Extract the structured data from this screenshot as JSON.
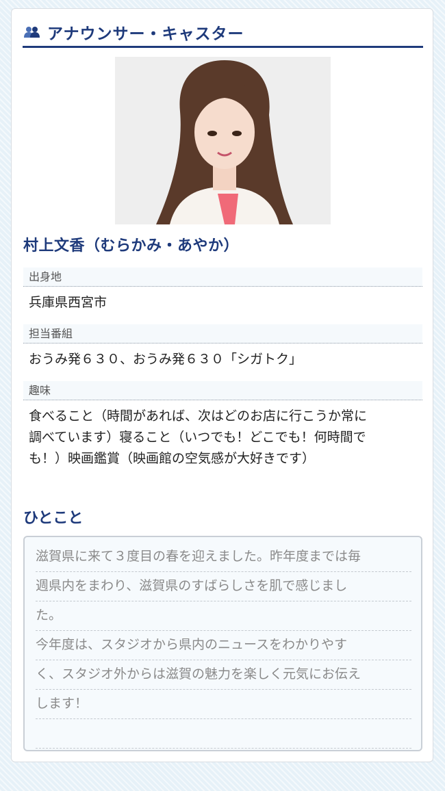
{
  "section": {
    "title": "アナウンサー・キャスター",
    "icon": "people-icon",
    "accent_color": "#1e3a7b"
  },
  "profile": {
    "name": "村上文香（むらかみ・あやか）",
    "fields": [
      {
        "label": "出身地",
        "value_lines": [
          "兵庫県西宮市"
        ]
      },
      {
        "label": "担当番組",
        "value_lines": [
          "おうみ発６３０、おうみ発６３０「シガトク」"
        ]
      },
      {
        "label": "趣味",
        "value_lines": [
          "食べること（時間があれば、次はどのお店に行こうか常に",
          "調べています）寝ること（いつでも！どこでも！何時間で",
          "も！）映画鑑賞（映画館の空気感が大好きです）"
        ]
      }
    ]
  },
  "hitokoto": {
    "title": "ひとこと",
    "lines": [
      "滋賀県に来て３度目の春を迎えました。昨年度までは毎",
      "週県内をまわり、滋賀県のすばらしさを肌で感じまし",
      "た。",
      "今年度は、スタジオから県内のニュースをわかりやす",
      "く、スタジオ外からは滋賀の魅力を楽しく元気にお伝え",
      "します！",
      ""
    ]
  }
}
